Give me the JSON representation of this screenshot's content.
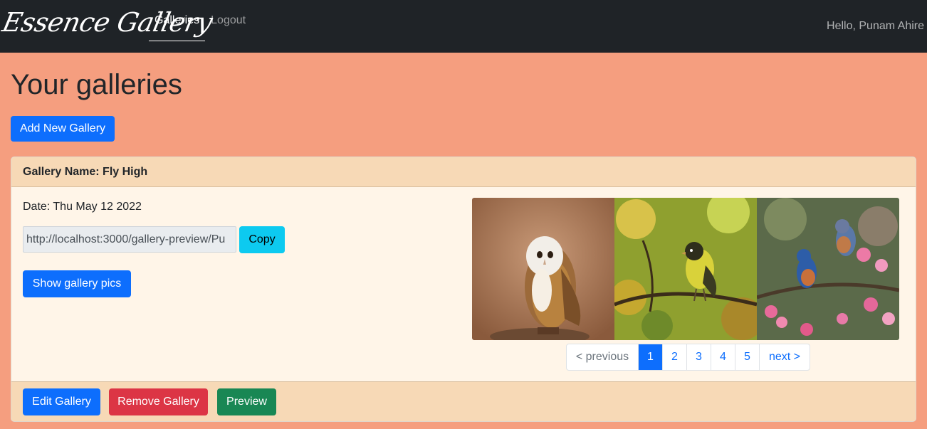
{
  "navbar": {
    "brand": "Essence Gallery",
    "links": [
      {
        "label": "Galleries",
        "active": true
      },
      {
        "label": "Logout",
        "active": false
      }
    ],
    "greeting": "Hello, Punam Ahire"
  },
  "page": {
    "title": "Your galleries",
    "add_button": "Add New Gallery"
  },
  "gallery": {
    "header": "Gallery Name: Fly High",
    "date": "Date: Thu May 12 2022",
    "url_value": "http://localhost:3000/gallery-preview/Pu",
    "copy_label": "Copy",
    "show_pics_label": "Show gallery pics",
    "photos": [
      "owl-photo",
      "yellow-bird-photo",
      "bluebird-photo"
    ],
    "pagination": {
      "previous": "< previous",
      "pages": [
        "1",
        "2",
        "3",
        "4",
        "5"
      ],
      "current": "1",
      "next": "next >"
    },
    "footer": {
      "edit_label": "Edit Gallery",
      "remove_label": "Remove Gallery",
      "preview_label": "Preview"
    }
  },
  "colors": {
    "page_bg": "#f59e7f",
    "navbar_bg": "#1f2327",
    "card_bg": "#fff5e8",
    "card_header_bg": "#f7d9b6",
    "primary": "#0d6efd",
    "danger": "#dc3545",
    "success": "#198754",
    "info": "#0dcaf0"
  }
}
